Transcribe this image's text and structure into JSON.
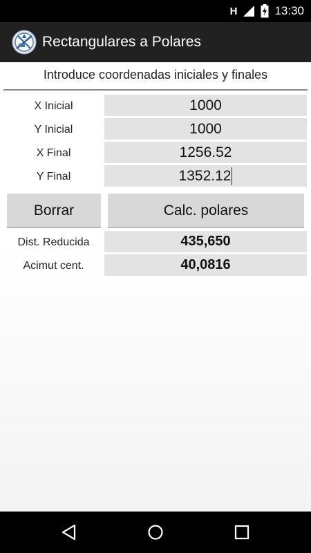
{
  "status_bar": {
    "network_type": "H",
    "time": "13:30"
  },
  "action_bar": {
    "title": "Rectangulares a Polares",
    "icon": "compass-app-icon"
  },
  "form": {
    "header": "Introduce coordenadas iniciales y finales",
    "fields": [
      {
        "label": "X Inicial",
        "value": "1000"
      },
      {
        "label": "Y Inicial",
        "value": "1000"
      },
      {
        "label": "X Final",
        "value": "1256.52"
      },
      {
        "label": "Y Final",
        "value": "1352.12"
      }
    ]
  },
  "buttons": {
    "clear_label": "Borrar",
    "calc_label": "Calc. polares"
  },
  "results": [
    {
      "label": "Dist. Reducida",
      "value": "435,650"
    },
    {
      "label": "Acimut cent.",
      "value": "40,0816"
    }
  ],
  "nav_bar": {
    "icons": [
      "back-icon",
      "home-icon",
      "recents-icon"
    ]
  },
  "colors": {
    "action_bar": "#212121",
    "field_bg": "#e3e3e3",
    "button_bg": "#d8d8d8"
  }
}
